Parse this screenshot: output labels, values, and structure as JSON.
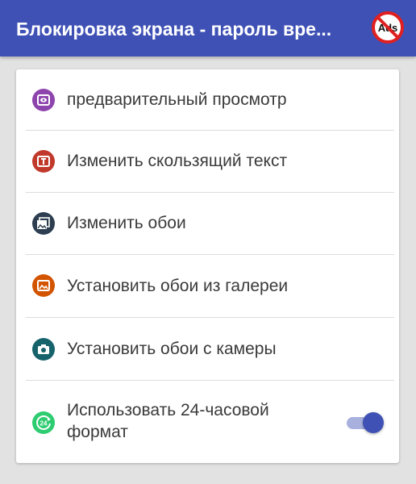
{
  "header": {
    "title": "Блокировка экрана - пароль вре...",
    "no_ads_badge": "Ads",
    "background_color": "#3f51b5"
  },
  "settings": {
    "items": [
      {
        "label": "предварительный просмотр",
        "icon": "preview-eye-icon",
        "icon_color": "#8e44ad"
      },
      {
        "label": "Изменить скользящий текст",
        "icon": "sliding-text-icon",
        "icon_color": "#c0392b"
      },
      {
        "label": "Изменить обои",
        "icon": "wallpapers-icon",
        "icon_color": "#2c3e50"
      },
      {
        "label": "Установить обои из галереи",
        "icon": "gallery-image-icon",
        "icon_color": "#d35400"
      },
      {
        "label": "Установить обои с камеры",
        "icon": "camera-icon",
        "icon_color": "#16636b"
      }
    ],
    "format_24h": {
      "label_line1": "Использовать 24-часовой",
      "label_line2": "формат",
      "icon": "clock-24-icon",
      "icon_color": "#2ecc71",
      "enabled": true,
      "toggle_color": "#3f51b5"
    }
  }
}
